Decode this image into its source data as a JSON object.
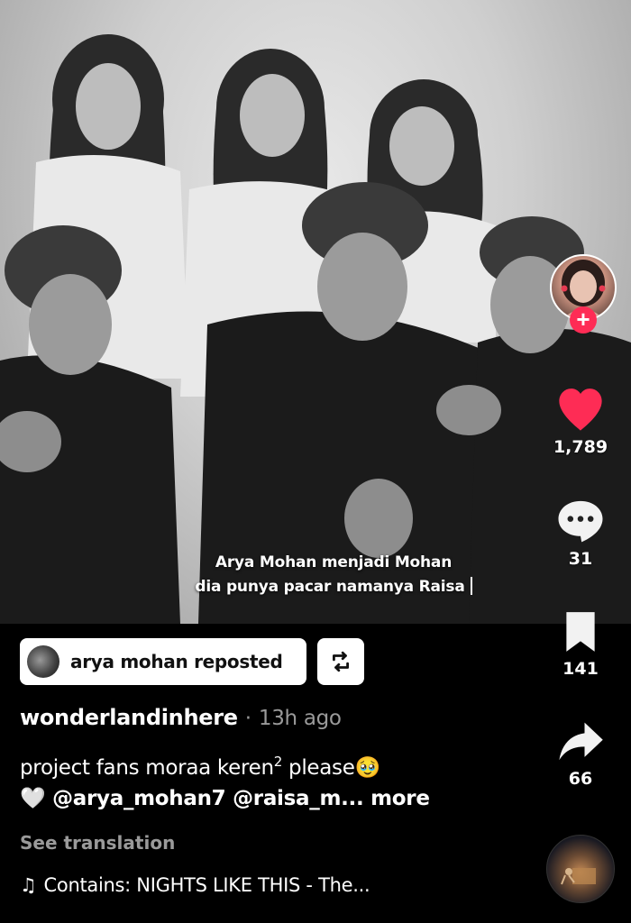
{
  "video": {
    "subtitle_line1": "Arya Mohan menjadi Mohan",
    "subtitle_line2": "dia punya pacar namanya Raisa"
  },
  "rail": {
    "follow_symbol": "+",
    "likes": "1,789",
    "comments": "31",
    "saves": "141",
    "shares": "66",
    "like_color": "#fe2c55"
  },
  "repost": {
    "label": "arya mohan reposted"
  },
  "post": {
    "author": "wonderlandinhere",
    "separator": "·",
    "time": "13h ago",
    "caption_text": "project fans moraa keren",
    "caption_sup": "2",
    "caption_tail": " please",
    "caption_emoji": "🥹",
    "heart_emoji": "🤍",
    "mentions": "@arya_mohan7 @raisa_m...",
    "more_label": "more",
    "see_translation": "See translation"
  },
  "music": {
    "note_icon": "♫",
    "label": "Contains: NIGHTS LIKE THIS - The..."
  }
}
